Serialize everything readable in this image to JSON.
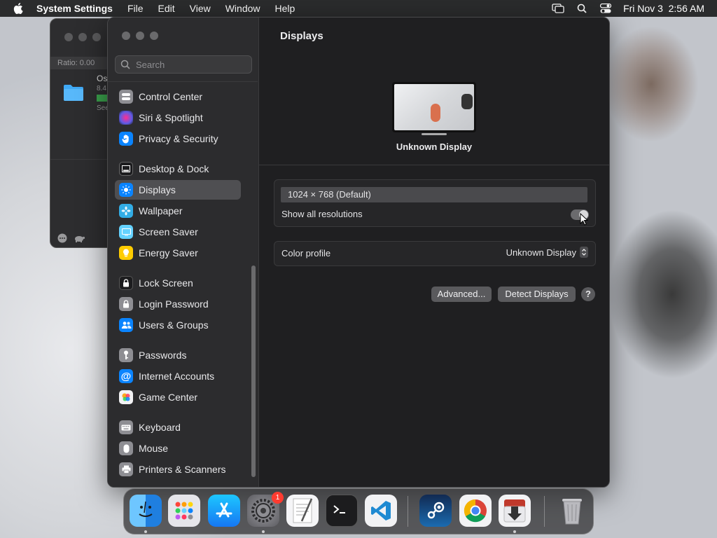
{
  "menubar": {
    "app_name": "System Settings",
    "menus": [
      "File",
      "Edit",
      "View",
      "Window",
      "Help"
    ],
    "clock": "Fri Nov 3  2:56 AM"
  },
  "background_window": {
    "ratio_label": "Ratio: 0.00",
    "item_name": "Os",
    "item_size": "8.4",
    "item_link": "See"
  },
  "sidebar": {
    "search_placeholder": "Search",
    "items": [
      {
        "label": "Control Center",
        "icon": "control-center-icon",
        "color": "#8e8e93"
      },
      {
        "label": "Siri & Spotlight",
        "icon": "siri-icon",
        "color": "#bf5af2"
      },
      {
        "label": "Privacy & Security",
        "icon": "hand-icon",
        "color": "#0a84ff"
      },
      {
        "label": "Desktop & Dock",
        "icon": "dock-icon",
        "color": "#1c1c1e"
      },
      {
        "label": "Displays",
        "icon": "sun-icon",
        "color": "#0a84ff"
      },
      {
        "label": "Wallpaper",
        "icon": "flower-icon",
        "color": "#32ade6"
      },
      {
        "label": "Screen Saver",
        "icon": "screen-saver-icon",
        "color": "#64d2ff"
      },
      {
        "label": "Energy Saver",
        "icon": "bulb-icon",
        "color": "#ffcc00"
      },
      {
        "label": "Lock Screen",
        "icon": "lock-icon",
        "color": "#1c1c1e"
      },
      {
        "label": "Login Password",
        "icon": "padlock-icon",
        "color": "#8e8e93"
      },
      {
        "label": "Users & Groups",
        "icon": "users-icon",
        "color": "#0a84ff"
      },
      {
        "label": "Passwords",
        "icon": "key-icon",
        "color": "#8e8e93"
      },
      {
        "label": "Internet Accounts",
        "icon": "at-icon",
        "color": "#0a84ff"
      },
      {
        "label": "Game Center",
        "icon": "game-center-icon",
        "color": "#ffffff"
      },
      {
        "label": "Keyboard",
        "icon": "keyboard-icon",
        "color": "#8e8e93"
      },
      {
        "label": "Mouse",
        "icon": "mouse-icon",
        "color": "#8e8e93"
      },
      {
        "label": "Printers & Scanners",
        "icon": "printer-icon",
        "color": "#8e8e93"
      }
    ],
    "active": "Displays"
  },
  "main": {
    "title": "Displays",
    "display_name": "Unknown Display",
    "resolution": "1024 × 768 (Default)",
    "show_all_label": "Show all resolutions",
    "show_all_on": true,
    "color_profile_label": "Color profile",
    "color_profile_value": "Unknown Display",
    "advanced_button": "Advanced...",
    "detect_button": "Detect Displays",
    "help_button": "?"
  },
  "dock": {
    "apps": [
      "Finder",
      "Launchpad",
      "App Store",
      "System Settings",
      "TextEdit",
      "Terminal",
      "Visual Studio Code",
      "Steam",
      "Google Chrome",
      "Downloader",
      "Trash"
    ],
    "system_settings_badge": "1"
  }
}
